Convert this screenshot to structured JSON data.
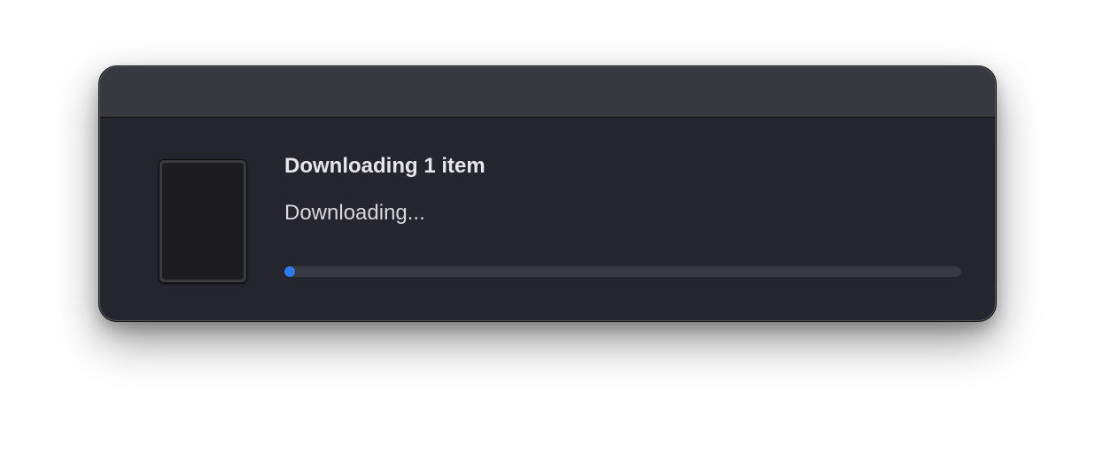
{
  "dialog": {
    "title": "Downloading 1 item",
    "status": "Downloading...",
    "progress": 0.0,
    "accent_color": "#2d7bf0",
    "icon": "tablet-device-icon"
  }
}
